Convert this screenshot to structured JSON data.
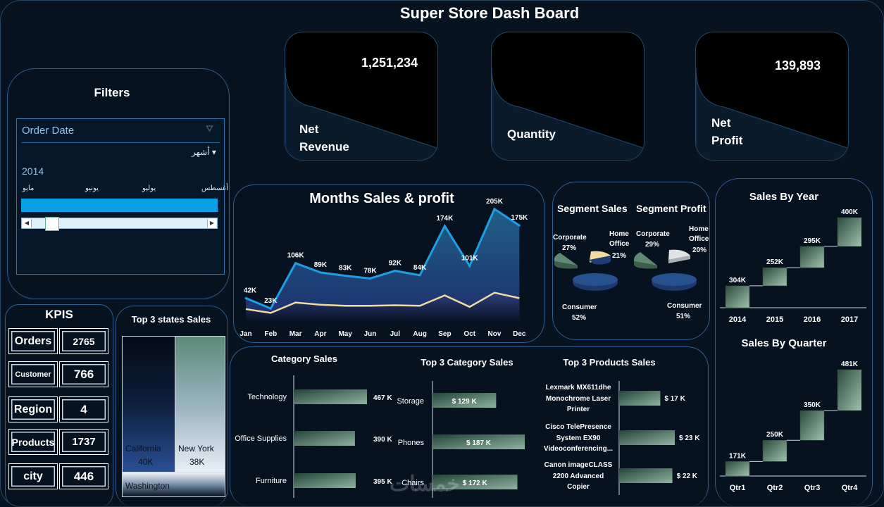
{
  "header": {
    "title": "Super Store Dash Board"
  },
  "kpis": [
    {
      "label_1": "Net",
      "label_2": "Revenue",
      "value": "1,251,234"
    },
    {
      "label_1": "Quantity",
      "label_2": "",
      "value": ""
    },
    {
      "label_1": "Net",
      "label_2": "Profit",
      "value": "139,893"
    }
  ],
  "filters": {
    "title": "Filters",
    "slicer_title": "Order Date",
    "level": "أشهر",
    "year": "2014",
    "months": [
      "مايو",
      "يونيو",
      "يوليو",
      "أغسطس"
    ]
  },
  "kpi_table": {
    "title": "KPIS",
    "rows": [
      {
        "label": "Orders",
        "value": "2765"
      },
      {
        "label": "Customer",
        "value": "766"
      },
      {
        "label": "Region",
        "value": "4"
      },
      {
        "label": "Products",
        "value": "1737"
      },
      {
        "label": "city",
        "value": "446"
      }
    ]
  },
  "states": {
    "title": "Top 3 states Sales",
    "items": [
      {
        "name": "California",
        "value": "40K"
      },
      {
        "name": "New York",
        "value": "38K"
      },
      {
        "name": "Washington",
        "value": ""
      }
    ]
  },
  "monthly": {
    "title": "Months Sales  & profit",
    "months": [
      "Jan",
      "Feb",
      "Mar",
      "Apr",
      "May",
      "Jun",
      "Jul",
      "Aug",
      "Sep",
      "Oct",
      "Nov",
      "Dec"
    ],
    "sales": [
      42,
      23,
      106,
      89,
      83,
      78,
      92,
      84,
      174,
      101,
      205,
      175
    ],
    "profit": [
      10,
      3,
      22,
      18,
      16,
      16,
      17,
      16,
      35,
      14,
      40,
      30
    ],
    "labels": [
      "42K",
      "23K",
      "106K",
      "89K",
      "83K",
      "78K",
      "92K",
      "84K",
      "174K",
      "101K",
      "205K",
      "175K"
    ],
    "colors": {
      "sales": "#1f9ee3",
      "profit": "#f0dca0"
    }
  },
  "segments": {
    "sales_title": "Segment Sales",
    "profit_title": "Segment Profit",
    "sales": [
      {
        "name": "Corporate",
        "pct": "27%"
      },
      {
        "name": "Home Office",
        "pct": "21%"
      },
      {
        "name": "Consumer",
        "pct": "52%"
      }
    ],
    "profit": [
      {
        "name": "Corporate",
        "pct": "29%"
      },
      {
        "name": "Home Office",
        "pct": "20%"
      },
      {
        "name": "Consumer",
        "pct": "51%"
      }
    ]
  },
  "category_sales": {
    "title": "Category Sales",
    "items": [
      {
        "name": "Technology",
        "value": 467,
        "label": "467 K"
      },
      {
        "name": "Office Supplies",
        "value": 390,
        "label": "390 K"
      },
      {
        "name": "Furniture",
        "value": 395,
        "label": "395 K"
      }
    ]
  },
  "top_category": {
    "title": "Top 3 Category Sales",
    "items": [
      {
        "name": "Storage",
        "value": 129,
        "label": "$ 129 K"
      },
      {
        "name": "Phones",
        "value": 187,
        "label": "$ 187 K"
      },
      {
        "name": "Chairs",
        "value": 172,
        "label": "$ 172 K"
      }
    ]
  },
  "top_products": {
    "title": "Top 3 Products  Sales",
    "items": [
      {
        "line1": "Lexmark MX611dhe",
        "line2": "Monochrome Laser",
        "line3": "Printer",
        "value": 17,
        "label": "$ 17 K"
      },
      {
        "line1": "Cisco TelePresence",
        "line2": "System EX90",
        "line3": "Videoconferencing...",
        "value": 23,
        "label": "$ 23 K"
      },
      {
        "line1": "Canon imageCLASS",
        "line2": "2200 Advanced",
        "line3": "Copier",
        "value": 22,
        "label": "$ 22 K"
      }
    ]
  },
  "chart_data": [
    {
      "type": "area",
      "title": "Months Sales  & profit",
      "categories": [
        "Jan",
        "Feb",
        "Mar",
        "Apr",
        "May",
        "Jun",
        "Jul",
        "Aug",
        "Sep",
        "Oct",
        "Nov",
        "Dec"
      ],
      "series": [
        {
          "values": [
            42,
            23,
            106,
            89,
            83,
            78,
            92,
            84,
            174,
            101,
            205,
            175
          ]
        },
        {
          "values": [
            10,
            3,
            22,
            18,
            16,
            16,
            17,
            16,
            35,
            14,
            40,
            30
          ]
        }
      ]
    },
    {
      "type": "bar",
      "title": "Sales By Year",
      "categories": [
        "2014",
        "2015",
        "2016",
        "2017"
      ],
      "values": [
        304,
        252,
        295,
        400
      ],
      "labels": [
        "304K",
        "252K",
        "295K",
        "400K"
      ]
    },
    {
      "type": "bar",
      "title": "Sales By Quarter",
      "categories": [
        "Qtr1",
        "Qtr2",
        "Qtr3",
        "Qtr4"
      ],
      "values": [
        171,
        250,
        350,
        481
      ],
      "labels": [
        "171K",
        "250K",
        "350K",
        "481K"
      ]
    }
  ],
  "watermark": "خمسات"
}
